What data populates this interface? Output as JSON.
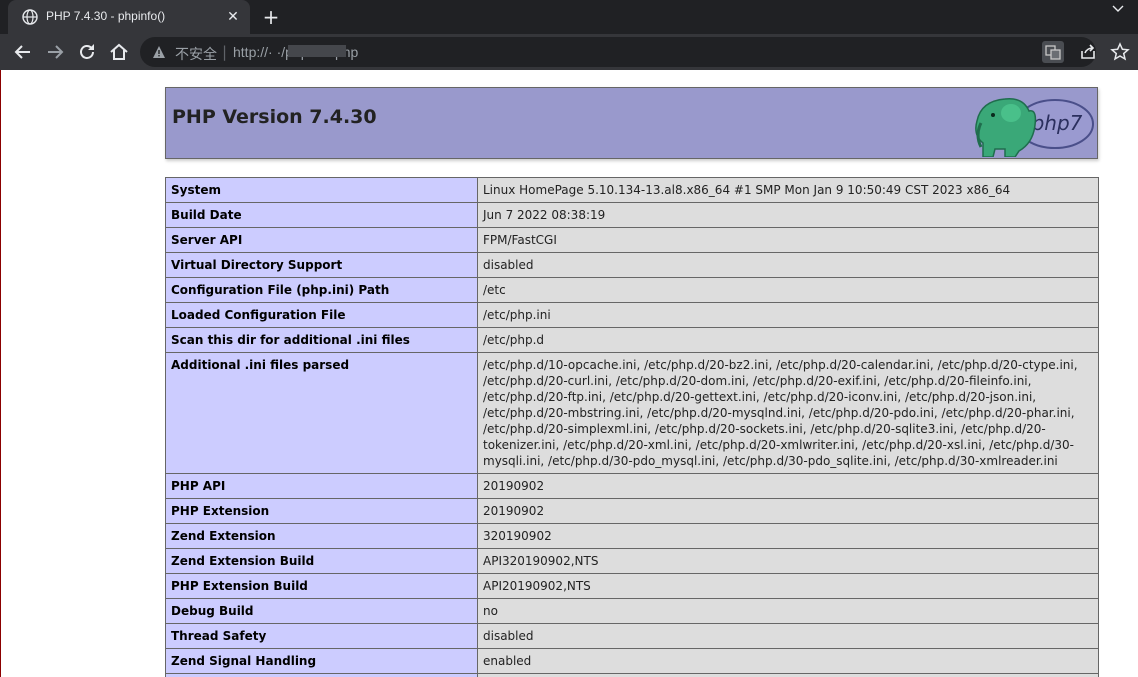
{
  "browser": {
    "tab_title": "PHP 7.4.30 - phpinfo()",
    "close_glyph": "✕",
    "new_tab_glyph": "+",
    "not_secure_label": "不安全",
    "url_separator": "|",
    "url": "http://·                    ·/phpinfo.php"
  },
  "icons": {
    "favicon": "globe-icon",
    "back": "arrow-left-icon",
    "forward": "arrow-right-icon",
    "reload": "reload-icon",
    "home": "home-icon",
    "warning": "warning-triangle-icon",
    "translate": "translate-icon",
    "share": "share-icon",
    "bookmark": "star-icon",
    "tab_search": "chevron-down-icon"
  },
  "colors": {
    "header_bg": "#9999cc",
    "key_bg": "#ccccff",
    "value_bg": "#dddddd",
    "chrome_dark": "#202124",
    "chrome_toolbar": "#35363a"
  },
  "page": {
    "title": "PHP Version 7.4.30",
    "logo_text": "php7",
    "rows": [
      {
        "key": "System",
        "value": "Linux HomePage 5.10.134-13.al8.x86_64 #1 SMP Mon Jan 9 10:50:49 CST 2023 x86_64"
      },
      {
        "key": "Build Date",
        "value": "Jun 7 2022 08:38:19"
      },
      {
        "key": "Server API",
        "value": "FPM/FastCGI"
      },
      {
        "key": "Virtual Directory Support",
        "value": "disabled"
      },
      {
        "key": "Configuration File (php.ini) Path",
        "value": "/etc"
      },
      {
        "key": "Loaded Configuration File",
        "value": "/etc/php.ini"
      },
      {
        "key": "Scan this dir for additional .ini files",
        "value": "/etc/php.d"
      },
      {
        "key": "Additional .ini files parsed",
        "value": "/etc/php.d/10-opcache.ini, /etc/php.d/20-bz2.ini, /etc/php.d/20-calendar.ini, /etc/php.d/20-ctype.ini, /etc/php.d/20-curl.ini, /etc/php.d/20-dom.ini, /etc/php.d/20-exif.ini, /etc/php.d/20-fileinfo.ini, /etc/php.d/20-ftp.ini, /etc/php.d/20-gettext.ini, /etc/php.d/20-iconv.ini, /etc/php.d/20-json.ini, /etc/php.d/20-mbstring.ini, /etc/php.d/20-mysqlnd.ini, /etc/php.d/20-pdo.ini, /etc/php.d/20-phar.ini, /etc/php.d/20-simplexml.ini, /etc/php.d/20-sockets.ini, /etc/php.d/20-sqlite3.ini, /etc/php.d/20-tokenizer.ini, /etc/php.d/20-xml.ini, /etc/php.d/20-xmlwriter.ini, /etc/php.d/20-xsl.ini, /etc/php.d/30-mysqli.ini, /etc/php.d/30-pdo_mysql.ini, /etc/php.d/30-pdo_sqlite.ini, /etc/php.d/30-xmlreader.ini"
      },
      {
        "key": "PHP API",
        "value": "20190902"
      },
      {
        "key": "PHP Extension",
        "value": "20190902"
      },
      {
        "key": "Zend Extension",
        "value": "320190902"
      },
      {
        "key": "Zend Extension Build",
        "value": "API320190902,NTS"
      },
      {
        "key": "PHP Extension Build",
        "value": "API20190902,NTS"
      },
      {
        "key": "Debug Build",
        "value": "no"
      },
      {
        "key": "Thread Safety",
        "value": "disabled"
      },
      {
        "key": "Zend Signal Handling",
        "value": "enabled"
      },
      {
        "key": "",
        "value": ""
      }
    ]
  }
}
